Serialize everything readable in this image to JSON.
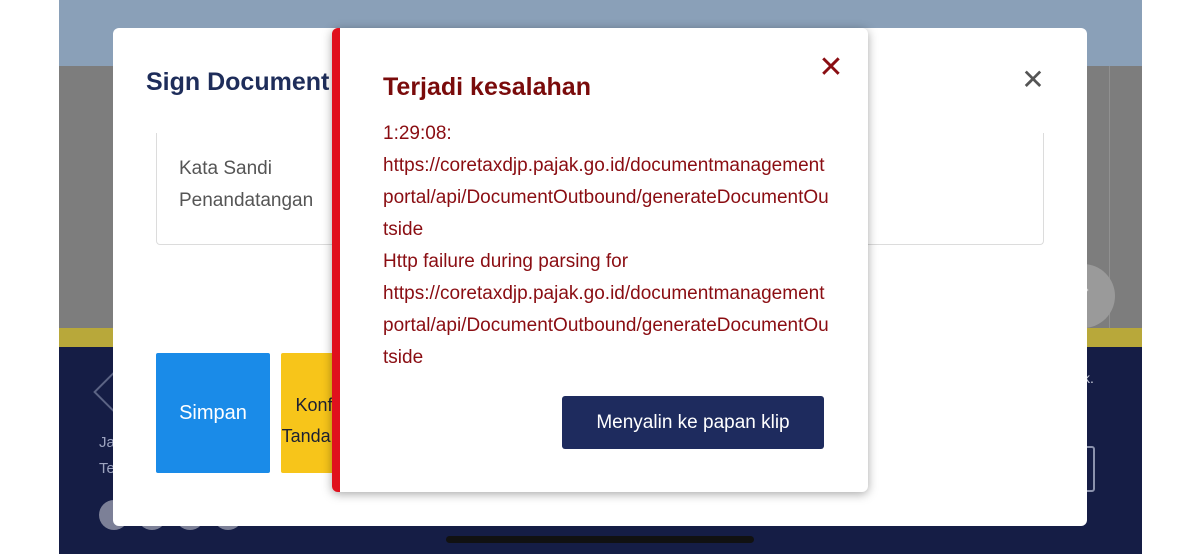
{
  "background": {
    "footer_texts": [
      "Ja",
      "Te"
    ],
    "footer_right_text": "k.",
    "fab_icon": "chevron-up-icon"
  },
  "sign_modal": {
    "title": "Sign Document",
    "field_label": "Kata Sandi Penandatangan",
    "save_button": "Simpan",
    "confirm_button_partial": "Konfirmasi Tanda Tangan"
  },
  "error_toast": {
    "title": "Terjadi kesalahan",
    "lines": [
      "1:29:08:",
      "https://coretaxdjp.pajak.go.id/documentmanagementportal/api/DocumentOutbound/generateDocumentOutside",
      "Http failure during parsing for",
      "https://coretaxdjp.pajak.go.id/documentmanagementportal/api/DocumentOutbound/generateDocumentOutside"
    ],
    "copy_button": "Menyalin ke papan klip",
    "accent_color": "#e0101d"
  }
}
